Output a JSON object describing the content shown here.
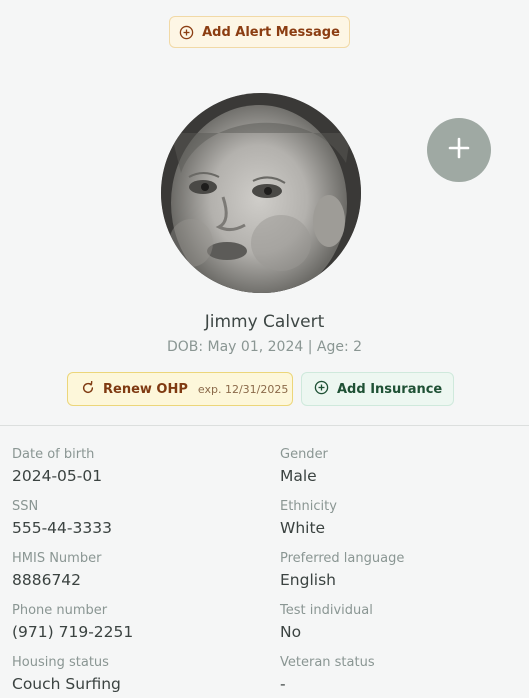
{
  "alert": {
    "label": "Add Alert Message",
    "icon": "plus-circle-icon",
    "color": "#8b3d12"
  },
  "profile": {
    "photo_icon": "avatar-photo",
    "add_photo_icon": "plus-icon",
    "name": "Jimmy Calvert",
    "dob_line": "DOB: May 01, 2024 | Age: 2"
  },
  "actions": {
    "renew": {
      "icon": "refresh-icon",
      "label": "Renew OHP",
      "expiry": "exp. 12/31/2025"
    },
    "insurance": {
      "icon": "plus-circle-icon",
      "label": "Add Insurance"
    }
  },
  "details": [
    {
      "label": "Date of birth",
      "value": "2024-05-01"
    },
    {
      "label": "Gender",
      "value": "Male"
    },
    {
      "label": "SSN",
      "value": "555-44-3333"
    },
    {
      "label": "Ethnicity",
      "value": "White"
    },
    {
      "label": "HMIS Number",
      "value": "8886742"
    },
    {
      "label": "Preferred language",
      "value": "English"
    },
    {
      "label": "Phone number",
      "value": "(971) 719-2251"
    },
    {
      "label": "Test individual",
      "value": "No"
    },
    {
      "label": "Housing status",
      "value": "Couch Surfing"
    },
    {
      "label": "Veteran status",
      "value": "-"
    }
  ],
  "colors": {
    "background": "#f5f6f6",
    "muted_text": "#8a9693",
    "primary_text": "#3b4341",
    "add_photo_button": "#9fa9a3"
  }
}
